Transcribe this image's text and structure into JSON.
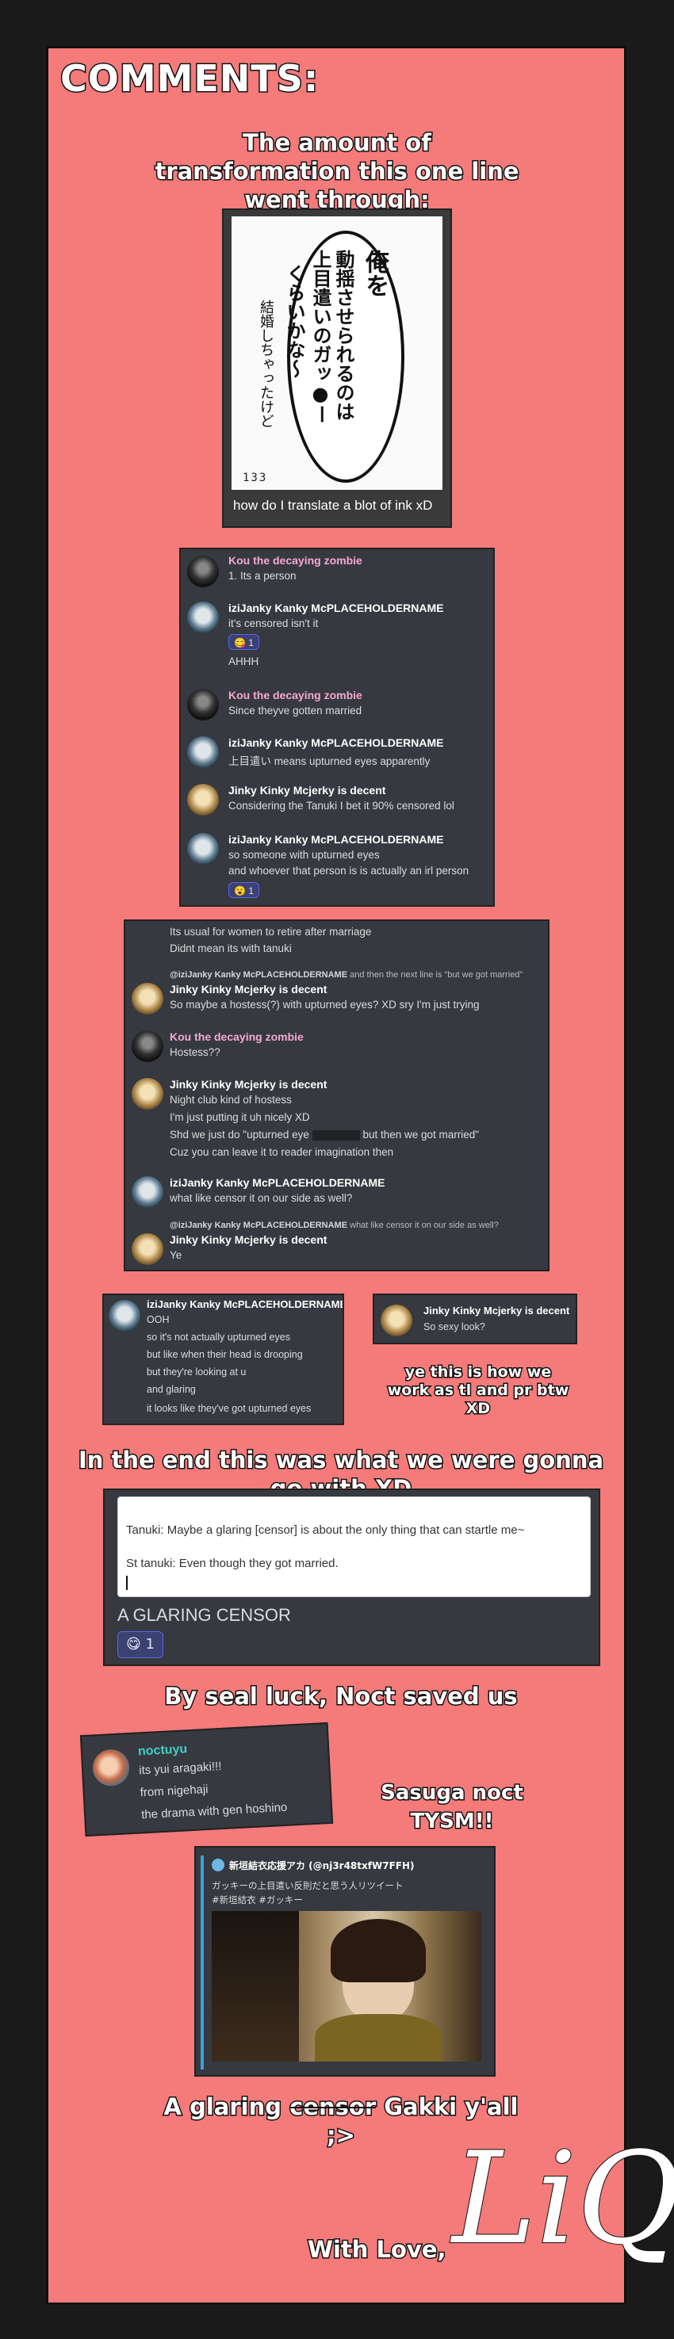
{
  "heading": "COMMENTS:",
  "captions": {
    "intro": "The amount of transformation this one line went through:",
    "tl_note": "ye this is how we work as tl and pr btw XD",
    "end": "In the end this was what we were gonna go with XD",
    "seal": "By seal luck, Noct saved us",
    "sasuga": "Sasuga noct TYSM!!",
    "glaring_pre": "A glaring",
    "glaring_strike": "censor",
    "glaring_post": "Gakki y'all ;>",
    "love": "With Love,",
    "signature": "LiQ"
  },
  "manga": {
    "col1": "俺を",
    "col2": "動揺させられるのは",
    "col3": "上目遣いのガッ●ー",
    "col4": "くらいかな〜",
    "col5": "結婚しちゃったけど",
    "page_no": "133",
    "footer": "how do I translate a blot of ink xD"
  },
  "chat1": [
    {
      "user": "Kou the decaying zombie",
      "lines": [
        "1. Its a person"
      ]
    },
    {
      "user": "iziJanky Kanky McPLACEHOLDERNAME",
      "lines": [
        "it's censored isn't it"
      ],
      "reaction": "1",
      "extra": "AHHH"
    },
    {
      "user": "Kou the decaying zombie",
      "lines": [
        "Since theyve gotten married"
      ]
    },
    {
      "user": "iziJanky Kanky McPLACEHOLDERNAME",
      "lines": [
        "上目遣い means upturned eyes apparently"
      ]
    },
    {
      "user": "Jinky Kinky Mcjerky is decent",
      "lines": [
        "Considering the Tanuki I bet it 90% censored lol"
      ]
    },
    {
      "user": "iziJanky Kanky McPLACEHOLDERNAME",
      "lines": [
        "so someone with upturned eyes",
        "and whoever that person is is actually an irl person"
      ],
      "reaction": "1"
    }
  ],
  "chat2": {
    "top_lines": [
      "Its usual for women to retire after marriage",
      "Didnt mean its with tanuki"
    ],
    "reply1_user": "@iziJanky Kanky McPLACEHOLDERNAME",
    "reply1_text": "and then the next line is \"but we got married\"",
    "jinky1_user": "Jinky Kinky Mcjerky is decent",
    "jinky1_line": "So maybe a hostess(?) with upturned eyes? XD sry I'm just trying",
    "kou_user": "Kou the decaying zombie",
    "kou_line": "Hostess??",
    "jinky2_user": "Jinky Kinky Mcjerky is decent",
    "jinky2_lines": [
      "Night club kind of hostess",
      "I'm just putting it uh nicely XD"
    ],
    "jinky2_shd_pre": "Shd we just do \"upturned eye",
    "jinky2_shd_post": "but then we got married\"",
    "jinky2_last": "Cuz you can leave it to reader imagination then",
    "izi_user": "iziJanky Kanky McPLACEHOLDERNAME",
    "izi_line": "what like censor it on our side as well?",
    "reply2_user": "@iziJanky Kanky McPLACEHOLDERNAME",
    "reply2_text": "what like censor it on our side as well?",
    "jinky3_user": "Jinky Kinky Mcjerky is decent",
    "jinky3_line": "Ye"
  },
  "chat3": {
    "user": "iziJanky Kanky McPLACEHOLDERNAME",
    "lines": [
      "OOH",
      "so it's not actually upturned eyes",
      "but like when their head is drooping",
      "but they're looking at u",
      "and glaring",
      "it looks like they've got upturned eyes"
    ]
  },
  "chat4": {
    "user": "Jinky Kinky Mcjerky is decent",
    "line": "So sexy look?"
  },
  "tl_box": {
    "line1": "Tanuki: Maybe a glaring [censor] is about the only thing that can startle me~",
    "line2": "St tanuki: Even though they got married.",
    "title": "A GLARING CENSOR",
    "reaction": "1"
  },
  "noct": {
    "user": "noctuyu",
    "lines": [
      "its yui aragaki!!!",
      "from nigehaji",
      "the drama with gen hoshino"
    ]
  },
  "tweet": {
    "account": "新垣結衣応援アカ (@nj3r48txfW7FFH)",
    "text1": "ガッキーの上目遣い反則だと思う人リツイート",
    "text2": "#新垣結衣 #ガッキー"
  }
}
